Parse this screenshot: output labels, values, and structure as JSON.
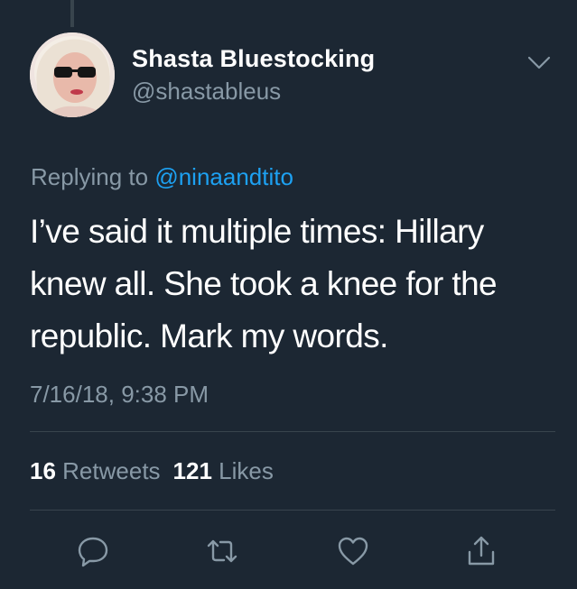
{
  "tweet": {
    "author": {
      "display_name": "Shasta Bluestocking",
      "handle": "@shastableus"
    },
    "replying_to": {
      "prefix": "Replying to",
      "mention": "@ninaandtito"
    },
    "text_lines": [
      "I’ve said it multiple times: Hillary",
      "knew all. She took a knee for the",
      "republic. Mark my words."
    ],
    "timestamp": "7/16/18, 9:38 PM",
    "stats": {
      "retweets_count": "16",
      "retweets_label": "Retweets",
      "likes_count": "121",
      "likes_label": "Likes"
    },
    "actions": [
      {
        "icon": "reply-icon"
      },
      {
        "icon": "retweet-icon"
      },
      {
        "icon": "like-heart-icon"
      },
      {
        "icon": "share-icon"
      }
    ]
  },
  "colors": {
    "background": "#1c2733",
    "text_primary": "#ffffff",
    "text_secondary": "#8899a6",
    "link": "#1da1f2",
    "divider": "#38444d"
  }
}
